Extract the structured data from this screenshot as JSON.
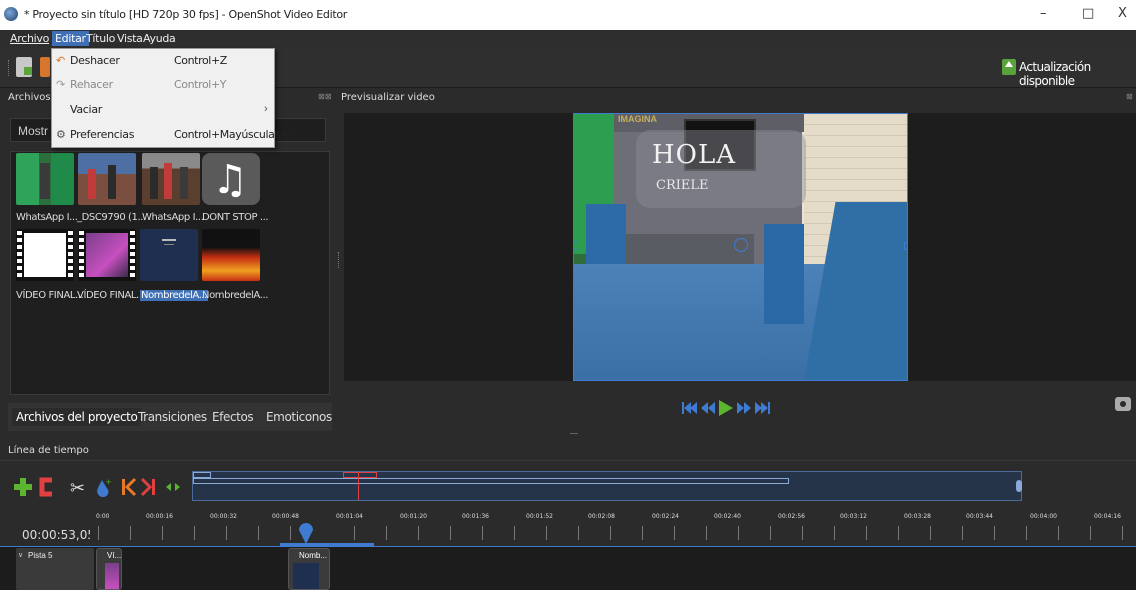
{
  "window": {
    "title": "* Proyecto sin título [HD 720p 30 fps] - OpenShot Video Editor",
    "controls": [
      "–",
      "□",
      "X"
    ]
  },
  "menubar": [
    "Archivo",
    "Editar",
    "Título",
    "Vista",
    "Ayuda"
  ],
  "edit_menu": [
    {
      "label": "Deshacer",
      "shortcut": "Control+Z",
      "icon": "undo-icon",
      "enabled": true
    },
    {
      "label": "Rehacer",
      "shortcut": "Control+Y",
      "icon": "redo-icon",
      "enabled": false
    },
    {
      "label": "Vaciar",
      "shortcut": "",
      "icon": "",
      "enabled": true,
      "submenu_arrow": "›"
    },
    {
      "label": "Preferencias",
      "shortcut": "Control+Mayúsculas+P",
      "icon": "gear-icon",
      "enabled": true
    }
  ],
  "toolbar": {
    "update_label": "Actualización disponible"
  },
  "project_files": {
    "header": "Archivos d",
    "filter_label": "Mostr",
    "items": [
      {
        "label": "WhatsApp I...",
        "icon": "video-thumbnail",
        "selected": false
      },
      {
        "label": "_DSC9790 (1...",
        "icon": "photo-thumbnail",
        "selected": false
      },
      {
        "label": "WhatsApp I...",
        "icon": "video-thumbnail",
        "selected": false
      },
      {
        "label": "DONT STOP ...",
        "icon": "music-note-icon",
        "selected": false
      },
      {
        "label": "VÍDEO FINAL...",
        "icon": "film-thumbnail",
        "selected": false
      },
      {
        "label": "VÍDEO FINAL...",
        "icon": "film-thumbnail",
        "selected": false
      },
      {
        "label": "NombredelA...",
        "icon": "title-thumbnail",
        "selected": true
      },
      {
        "label": "NombredelA...",
        "icon": "fire-thumbnail",
        "selected": false
      }
    ],
    "tabs": [
      "Archivos del proyecto",
      "Transiciones",
      "Efectos",
      "Emoticonos"
    ]
  },
  "preview": {
    "header": "Previsualizar video",
    "overlay_title": "HOLA",
    "overlay_subtitle": "CRIELE",
    "wall_text": "IMAGINA"
  },
  "timeline": {
    "label": "Línea de tiempo",
    "current_time": "00:00:53,05",
    "ruler": [
      "0:00",
      "00:00:16",
      "00:00:32",
      "00:00:48",
      "00:01:04",
      "00:01:20",
      "00:01:36",
      "00:01:52",
      "00:02:08",
      "00:02:24",
      "00:02:40",
      "00:02:56",
      "00:03:12",
      "00:03:28",
      "00:03:44",
      "00:04:00",
      "00:04:16"
    ],
    "track_name": "Pista 5",
    "clips": [
      {
        "label": "Ví..."
      },
      {
        "label": "Nomb..."
      }
    ]
  },
  "colors": {
    "accent": "#3f6fb5",
    "selection_border": "#3f7bd1",
    "background": "#2b2b2b"
  }
}
